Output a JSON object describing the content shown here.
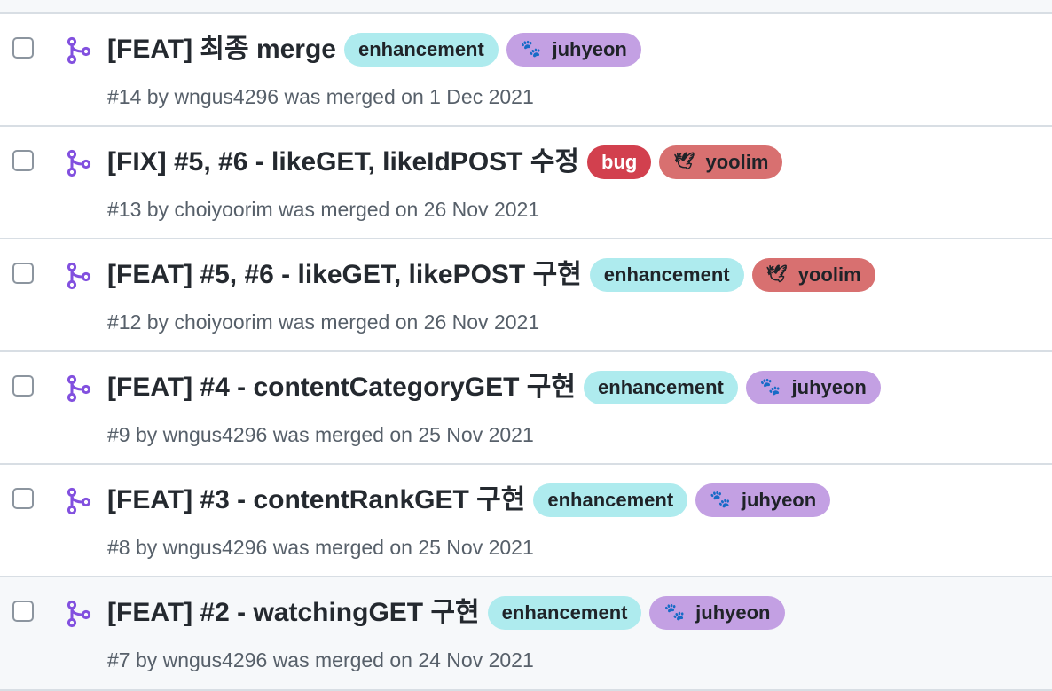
{
  "colors": {
    "merged_icon": "#8250df",
    "enhancement": "#aeebee",
    "bug": "#d2404e",
    "juhyeon": "#c3a0e3",
    "yoolim": "#d87070"
  },
  "pull_requests": [
    {
      "title": "[FEAT] 최종 merge",
      "labels": [
        {
          "text": "enhancement",
          "kind": "enh",
          "emoji": ""
        },
        {
          "text": "juhyeon",
          "kind": "juh",
          "emoji": "🐾"
        }
      ],
      "meta": "#14 by wngus4296 was merged on 1 Dec 2021"
    },
    {
      "title": "[FIX] #5, #6 - likeGET, likeIdPOST 수정",
      "labels": [
        {
          "text": "bug",
          "kind": "bug",
          "emoji": ""
        },
        {
          "text": "yoolim",
          "kind": "yoo",
          "emoji": "🕊"
        }
      ],
      "meta": "#13 by choiyoorim was merged on 26 Nov 2021"
    },
    {
      "title": "[FEAT] #5, #6 - likeGET, likePOST 구현",
      "labels": [
        {
          "text": "enhancement",
          "kind": "enh",
          "emoji": ""
        },
        {
          "text": "yoolim",
          "kind": "yoo",
          "emoji": "🕊"
        }
      ],
      "meta": "#12 by choiyoorim was merged on 26 Nov 2021"
    },
    {
      "title": "[FEAT] #4 - contentCategoryGET 구현",
      "labels": [
        {
          "text": "enhancement",
          "kind": "enh",
          "emoji": ""
        },
        {
          "text": "juhyeon",
          "kind": "juh",
          "emoji": "🐾"
        }
      ],
      "meta": "#9 by wngus4296 was merged on 25 Nov 2021"
    },
    {
      "title": "[FEAT] #3 - contentRankGET 구현",
      "labels": [
        {
          "text": "enhancement",
          "kind": "enh",
          "emoji": ""
        },
        {
          "text": "juhyeon",
          "kind": "juh",
          "emoji": "🐾"
        }
      ],
      "meta": "#8 by wngus4296 was merged on 25 Nov 2021"
    },
    {
      "title": "[FEAT] #2 - watchingGET 구현",
      "labels": [
        {
          "text": "enhancement",
          "kind": "enh",
          "emoji": ""
        },
        {
          "text": "juhyeon",
          "kind": "juh",
          "emoji": "🐾"
        }
      ],
      "meta": "#7 by wngus4296 was merged on 24 Nov 2021"
    }
  ]
}
